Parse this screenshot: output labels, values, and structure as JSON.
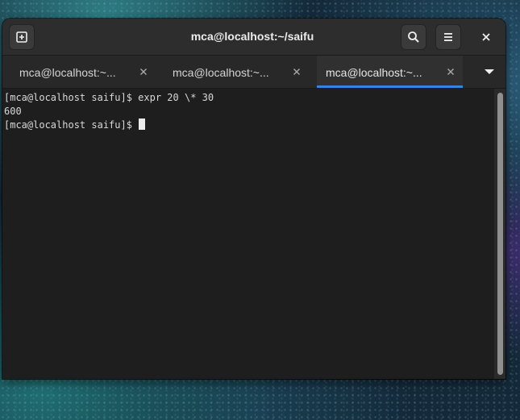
{
  "window": {
    "title": "mca@localhost:~/saifu"
  },
  "headerbar": {
    "new_tab_icon": "new-tab-icon",
    "search_icon": "search-icon",
    "menu_icon": "hamburger-menu-icon",
    "close_icon": "close-icon"
  },
  "tabs": [
    {
      "label": "mca@localhost:~...",
      "active": false
    },
    {
      "label": "mca@localhost:~...",
      "active": false
    },
    {
      "label": "mca@localhost:~...",
      "active": true
    }
  ],
  "tab_overflow_icon": "chevron-down-icon",
  "terminal": {
    "lines": [
      "[mca@localhost saifu]$ expr 20 \\* 30",
      "600",
      "[mca@localhost saifu]$"
    ]
  },
  "colors": {
    "accent": "#3584e4",
    "headerbar_bg": "#2d2d2d",
    "terminal_bg": "#1e1e1e",
    "terminal_fg": "#d8d8d8"
  }
}
